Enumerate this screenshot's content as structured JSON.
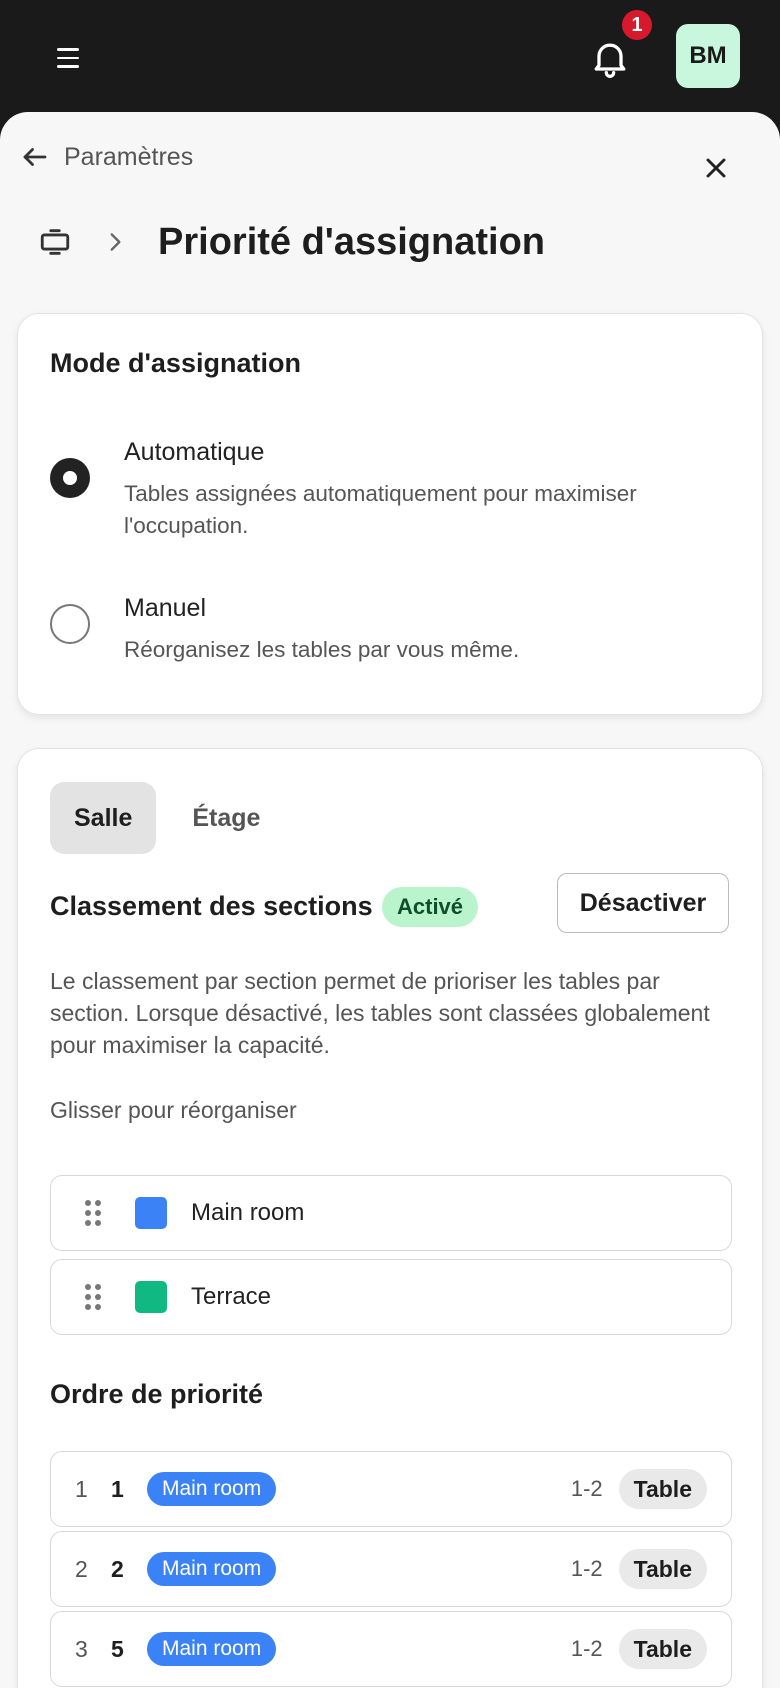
{
  "topbar": {
    "notification_count": "1",
    "avatar_initials": "BM"
  },
  "nav": {
    "back_label": "Paramètres",
    "page_title": "Priorité d'assignation"
  },
  "mode": {
    "title": "Mode d'assignation",
    "selected": "auto",
    "options": [
      {
        "title": "Automatique",
        "desc": "Tables assignées automatiquement pour maximiser l'occupation."
      },
      {
        "title": "Manuel",
        "desc": "Réorganisez les tables par vous même."
      }
    ]
  },
  "tabs": [
    {
      "label": "Salle",
      "active": true
    },
    {
      "label": "Étage",
      "active": false
    }
  ],
  "section_ranking": {
    "title": "Classement des sections",
    "status": "Activé",
    "toggle_label": "Désactiver",
    "description": "Le classement par section permet de prioriser les tables par section. Lorsque désactivé, les tables sont classées globalement pour maximiser la capacité.",
    "hint": "Glisser pour réorganiser",
    "sections": [
      {
        "name": "Main room",
        "color": "#3b82f6"
      },
      {
        "name": "Terrace",
        "color": "#10b981"
      }
    ]
  },
  "priority": {
    "title": "Ordre de priorité",
    "rows": [
      {
        "rank": "1",
        "table": "1",
        "section": "Main room",
        "capacity": "1-2",
        "type": "Table"
      },
      {
        "rank": "2",
        "table": "2",
        "section": "Main room",
        "capacity": "1-2",
        "type": "Table"
      },
      {
        "rank": "3",
        "table": "5",
        "section": "Main room",
        "capacity": "1-2",
        "type": "Table"
      }
    ]
  }
}
